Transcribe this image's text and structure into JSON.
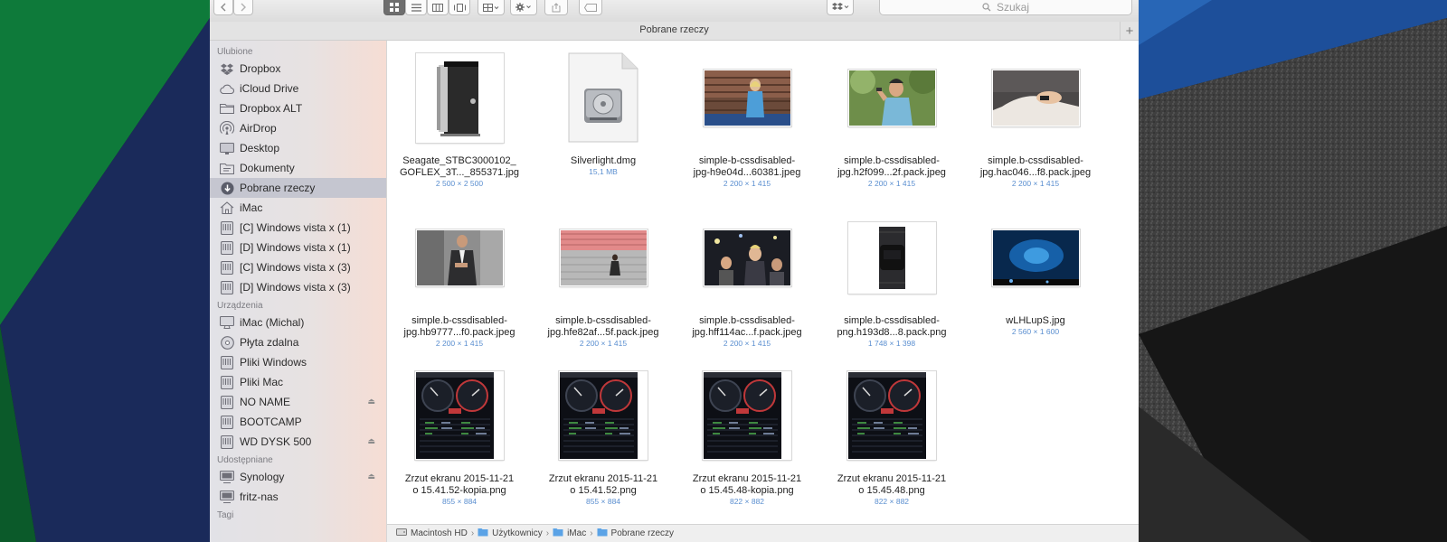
{
  "toolbar": {
    "search_placeholder": "Szukaj"
  },
  "window": {
    "title": "Pobrane rzeczy",
    "plus_label": "+"
  },
  "sidebar": {
    "sections": {
      "favorites": "Ulubione",
      "devices": "Urządzenia",
      "shared": "Udostępniane",
      "tags": "Tagi"
    },
    "favorites": [
      {
        "label": "Dropbox",
        "icon": "dropbox-icon"
      },
      {
        "label": "iCloud Drive",
        "icon": "cloud-icon"
      },
      {
        "label": "Dropbox ALT",
        "icon": "folder-icon"
      },
      {
        "label": "AirDrop",
        "icon": "airdrop-icon"
      },
      {
        "label": "Desktop",
        "icon": "desktop-icon"
      },
      {
        "label": "Dokumenty",
        "icon": "documents-icon"
      },
      {
        "label": "Pobrane rzeczy",
        "icon": "downloads-icon",
        "selected": true
      },
      {
        "label": "iMac",
        "icon": "home-icon"
      },
      {
        "label": "[C] Windows vista x (1)",
        "icon": "disk-icon"
      },
      {
        "label": "[D] Windows vista x (1)",
        "icon": "disk-icon"
      },
      {
        "label": "[C] Windows vista x (3)",
        "icon": "disk-icon"
      },
      {
        "label": "[D] Windows vista x (3)",
        "icon": "disk-icon"
      }
    ],
    "devices": [
      {
        "label": "iMac (Michal)",
        "icon": "imac-icon"
      },
      {
        "label": "Płyta zdalna",
        "icon": "optical-disc-icon"
      },
      {
        "label": "Pliki Windows",
        "icon": "drive-icon"
      },
      {
        "label": "Pliki Mac",
        "icon": "drive-icon"
      },
      {
        "label": "NO NAME",
        "icon": "drive-icon",
        "eject": true
      },
      {
        "label": "BOOTCAMP",
        "icon": "drive-icon"
      },
      {
        "label": "WD DYSK 500",
        "icon": "drive-icon",
        "eject": true
      }
    ],
    "shared": [
      {
        "label": "Synology",
        "icon": "server-icon",
        "eject": true
      },
      {
        "label": "fritz-nas",
        "icon": "server-icon"
      }
    ],
    "eject_glyph": "⏏"
  },
  "files": [
    {
      "name1": "Seagate_STBC3000102_",
      "name2": "GOFLEX_3T..._855371.jpg",
      "meta": "2 500 × 2 500",
      "kind": "seagate"
    },
    {
      "name1": "Silverlight.dmg",
      "name2": "",
      "meta": "15,1 MB",
      "kind": "dmg"
    },
    {
      "name1": "simple-b-cssdisabled-",
      "name2": "jpg-h9e04d...60381.jpeg",
      "meta": "2 200 × 1 415",
      "kind": "track"
    },
    {
      "name1": "simple.b-cssdisabled-",
      "name2": "jpg.h2f099...2f.pack.jpeg",
      "meta": "2 200 × 1 415",
      "kind": "runner"
    },
    {
      "name1": "simple.b-cssdisabled-",
      "name2": "jpg.hac046...f8.pack.jpeg",
      "meta": "2 200 × 1 415",
      "kind": "sleep"
    },
    {
      "name1": "simple.b-cssdisabled-",
      "name2": "jpg.hb9777...f0.pack.jpeg",
      "meta": "2 200 × 1 415",
      "kind": "office"
    },
    {
      "name1": "simple.b-cssdisabled-",
      "name2": "jpg.hfe82af...5f.pack.jpeg",
      "meta": "2 200 × 1 415",
      "kind": "stadium"
    },
    {
      "name1": "simple.b-cssdisabled-",
      "name2": "jpg.hff114ac...f.pack.jpeg",
      "meta": "2 200 × 1 415",
      "kind": "gym"
    },
    {
      "name1": "simple.b-cssdisabled-",
      "name2": "png.h193d8...8.pack.png",
      "meta": "1 748 × 1 398",
      "kind": "band"
    },
    {
      "name1": "wLHLupS.jpg",
      "name2": "",
      "meta": "2 560 × 1 600",
      "kind": "wallpaper"
    },
    {
      "name1": "Zrzut ekranu 2015-11-21",
      "name2": "o 15.41.52-kopia.png",
      "meta": "855 × 884",
      "kind": "speed"
    },
    {
      "name1": "Zrzut ekranu 2015-11-21",
      "name2": "o 15.41.52.png",
      "meta": "855 × 884",
      "kind": "speed"
    },
    {
      "name1": "Zrzut ekranu 2015-11-21",
      "name2": "o 15.45.48-kopia.png",
      "meta": "822 × 882",
      "kind": "speed"
    },
    {
      "name1": "Zrzut ekranu 2015-11-21",
      "name2": "o 15.45.48.png",
      "meta": "822 × 882",
      "kind": "speed"
    }
  ],
  "pathbar": [
    {
      "label": "Macintosh HD",
      "icon": "hard-drive-icon"
    },
    {
      "label": "Użytkownicy",
      "icon": "folder-icon"
    },
    {
      "label": "iMac",
      "icon": "home-icon"
    },
    {
      "label": "Pobrane rzeczy",
      "icon": "folder-icon"
    }
  ],
  "pathbar_sep": "›",
  "colors": {
    "selection": "#c5c6d0",
    "meta_blue": "#5b8fd0",
    "folder_blue": "#5ba3e6"
  }
}
